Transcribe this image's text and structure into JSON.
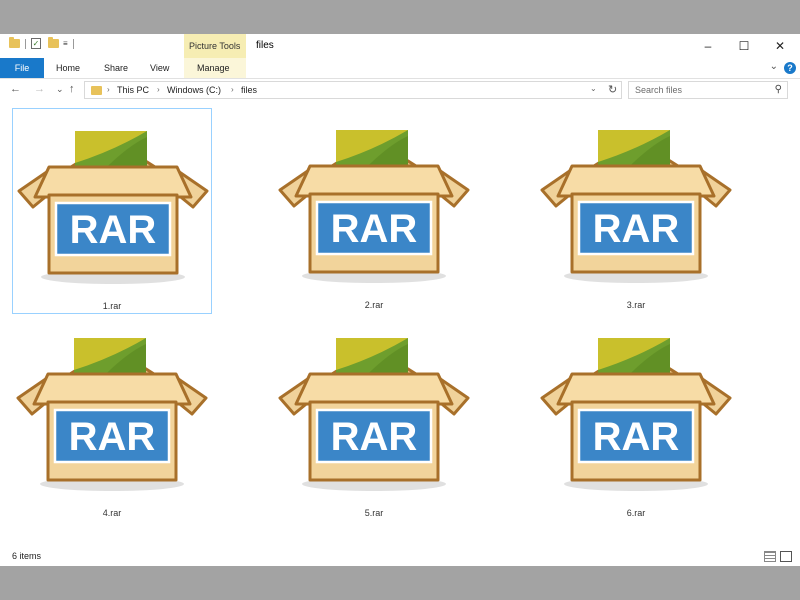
{
  "window": {
    "title": "files",
    "contextual_tab_group": "Picture Tools",
    "controls": {
      "minimize": "–",
      "maximize": "☐",
      "close": "✕"
    }
  },
  "ribbon": {
    "tabs": [
      "File",
      "Home",
      "Share",
      "View",
      "Manage"
    ]
  },
  "navigation": {
    "back": "←",
    "forward": "→",
    "recent": "⌄",
    "up": "↑"
  },
  "address": {
    "breadcrumbs": [
      "This PC",
      "Windows (C:)",
      "files"
    ]
  },
  "search": {
    "placeholder": "Search files"
  },
  "files": [
    {
      "name": "1.rar",
      "icon": "rar-archive-icon",
      "selected": true
    },
    {
      "name": "2.rar",
      "icon": "rar-archive-icon",
      "selected": false
    },
    {
      "name": "3.rar",
      "icon": "rar-archive-icon",
      "selected": false
    },
    {
      "name": "4.rar",
      "icon": "rar-archive-icon",
      "selected": false
    },
    {
      "name": "5.rar",
      "icon": "rar-archive-icon",
      "selected": false
    },
    {
      "name": "6.rar",
      "icon": "rar-archive-icon",
      "selected": false
    }
  ],
  "icon_text": "RAR",
  "status": {
    "items_count": "6 items"
  },
  "colors": {
    "accent": "#1979ca",
    "contextual_tab": "#f6edb3",
    "selection_border": "#99d1ff",
    "box_tan": "#f2d49b",
    "box_outline": "#a8702a",
    "rar_label": "#3b86c8"
  }
}
